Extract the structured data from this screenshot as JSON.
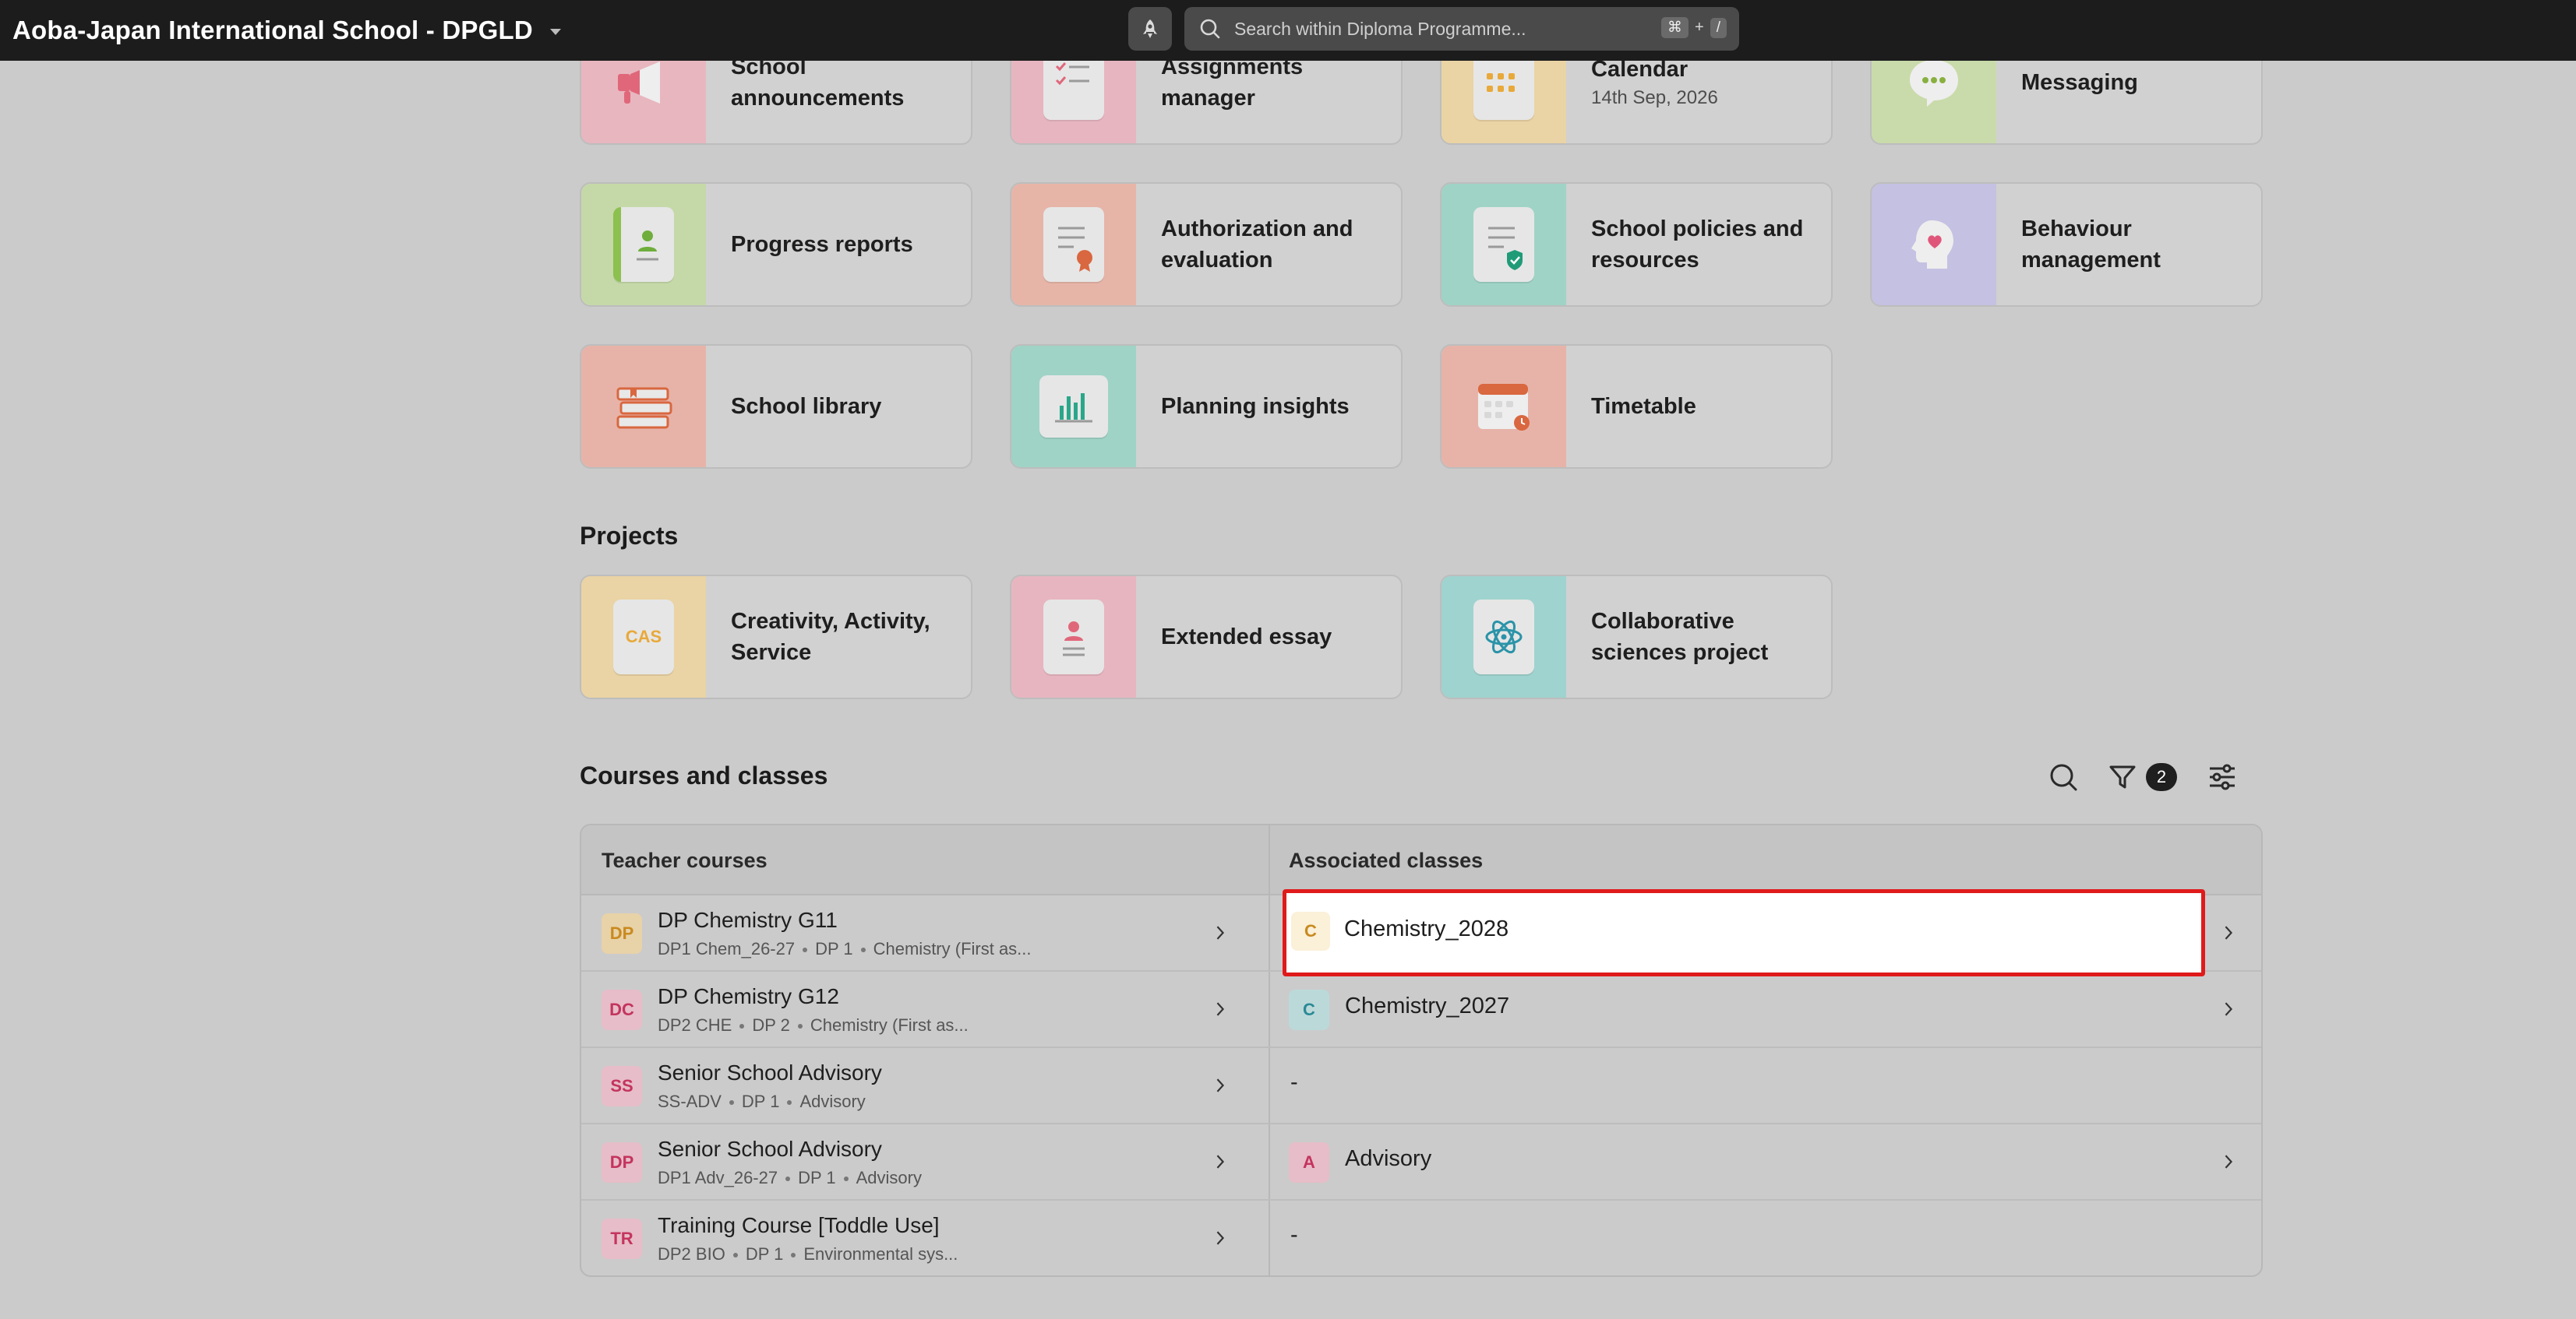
{
  "topbar": {
    "school_name": "Aoba-Japan International School - DPGLD",
    "search_placeholder": "Search within Diploma Programme...",
    "shortcut_key": "⌘",
    "shortcut_plus": "+",
    "shortcut_slash": "/"
  },
  "tiles": {
    "announcements": "School announcements",
    "assignments": "Assignments manager",
    "calendar": "Calendar",
    "calendar_date": "14th Sep, 2026",
    "messaging": "Messaging",
    "progress": "Progress reports",
    "authorization": "Authorization and evaluation",
    "policies": "School policies and resources",
    "behaviour": "Behaviour management",
    "library": "School library",
    "planning": "Planning insights",
    "timetable": "Timetable"
  },
  "projects": {
    "title": "Projects",
    "cas": "Creativity, Activity, Service",
    "cas_icon_text": "CAS",
    "essay": "Extended essay",
    "collab": "Collaborative sciences project"
  },
  "courses": {
    "title": "Courses and classes",
    "filter_count": "2",
    "col_teacher": "Teacher courses",
    "col_classes": "Associated classes",
    "rows": [
      {
        "abbr": "DP",
        "name": "DP Chemistry G11",
        "code": "DP1 Chem_26-27",
        "level": "DP 1",
        "subject": "Chemistry (First as...",
        "class_abbr": "C",
        "class_name": "Chemistry_2028"
      },
      {
        "abbr": "DC",
        "name": "DP Chemistry G12",
        "code": "DP2 CHE",
        "level": "DP 2",
        "subject": "Chemistry (First as...",
        "class_abbr": "C",
        "class_name": "Chemistry_2027"
      },
      {
        "abbr": "SS",
        "name": "Senior School Advisory",
        "code": "SS-ADV",
        "level": "DP 1",
        "subject": "Advisory",
        "class_empty": "-"
      },
      {
        "abbr": "DP",
        "name": "Senior School Advisory",
        "code": "DP1 Adv_26-27",
        "level": "DP 1",
        "subject": "Advisory",
        "class_abbr": "A",
        "class_name": "Advisory"
      },
      {
        "abbr": "TR",
        "name": "Training Course [Toddle Use]",
        "code": "DP2 BIO",
        "level": "DP 1",
        "subject": "Environmental sys...",
        "class_empty": "-"
      }
    ]
  },
  "colors": {
    "highlight_border": "#e01a1a",
    "topbar_bg": "#1c1c1c",
    "page_bg": "#cbcbcb"
  }
}
